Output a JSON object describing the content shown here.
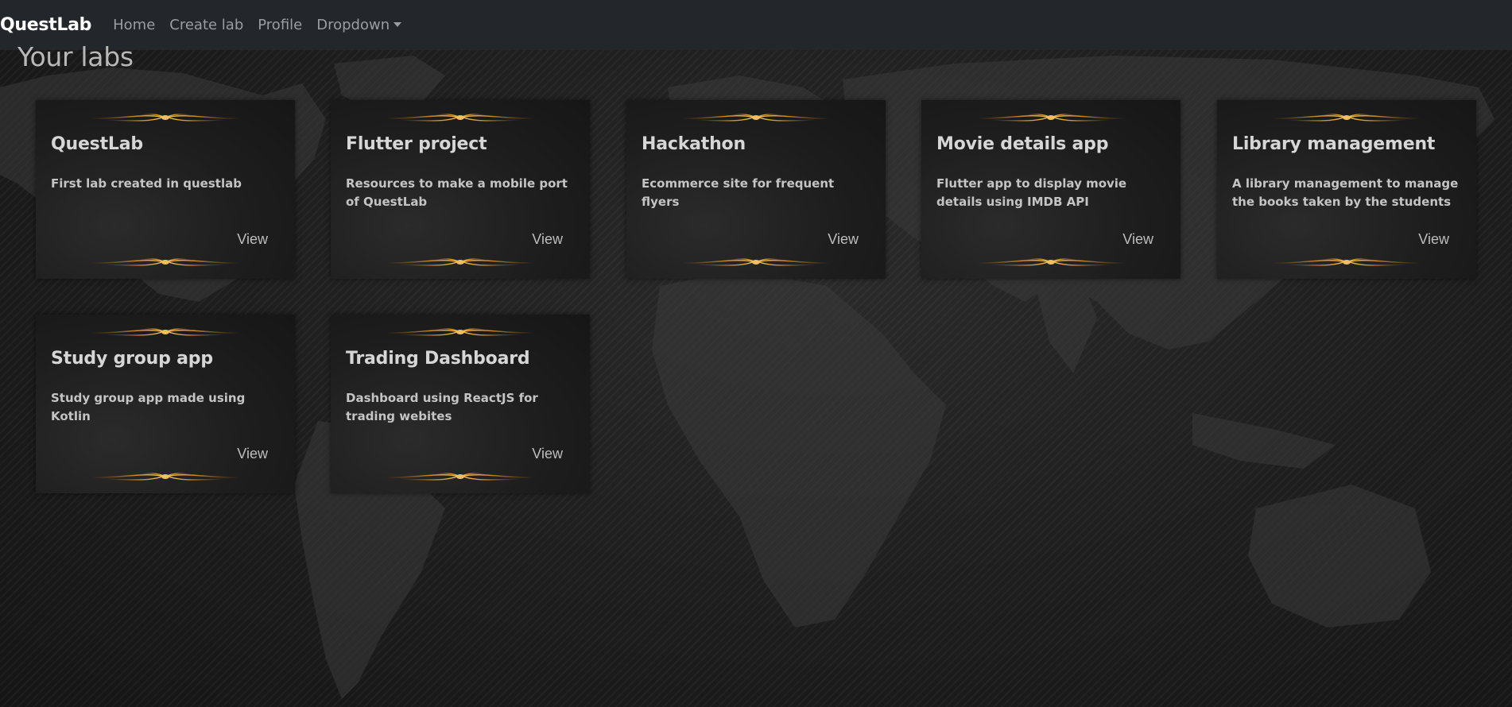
{
  "navbar": {
    "brand": "QuestLab",
    "links": [
      "Home",
      "Create lab",
      "Profile"
    ],
    "dropdown_label": "Dropdown"
  },
  "page": {
    "title": "Your labs"
  },
  "labs": [
    {
      "title": "QuestLab",
      "description": "First lab created in questlab",
      "action": "View"
    },
    {
      "title": "Flutter project",
      "description": "Resources to make a mobile port of QuestLab",
      "action": "View"
    },
    {
      "title": "Hackathon",
      "description": "Ecommerce site for frequent flyers",
      "action": "View"
    },
    {
      "title": "Movie details app",
      "description": "Flutter app to display movie details using IMDB API",
      "action": "View"
    },
    {
      "title": "Library management",
      "description": "A library management to manage the books taken by the students",
      "action": "View"
    },
    {
      "title": "Study group app",
      "description": "Study group app made using Kotlin",
      "action": "View"
    },
    {
      "title": "Trading Dashboard",
      "description": "Dashboard using ReactJS for trading webites",
      "action": "View"
    }
  ],
  "colors": {
    "navbar_bg": "#23262b",
    "ornament_gold": "#d9a43a",
    "card_bg": "#1f1f1f"
  },
  "icons": {
    "dropdown_caret": "chevron-down-icon",
    "card_ornament": "gold-flourish-ornament"
  }
}
